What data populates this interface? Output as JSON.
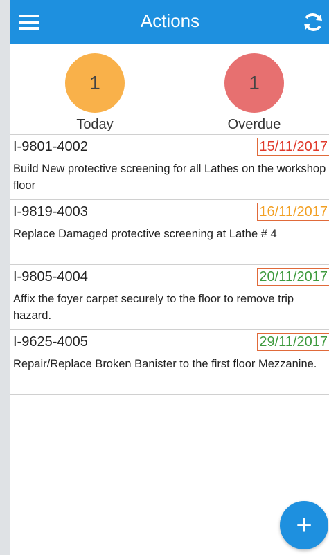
{
  "header": {
    "title": "Actions",
    "menu_icon": "hamburger-menu-icon",
    "sync_icon": "sync-icon"
  },
  "summary": {
    "today": {
      "count": "1",
      "label": "Today",
      "color": "#f9b14a"
    },
    "overdue": {
      "count": "1",
      "label": "Overdue",
      "color": "#e77070"
    }
  },
  "actions": [
    {
      "id": "I-9801-4002",
      "date": "15/11/2017",
      "date_color": "#e0392b",
      "description": "Build New protective screening for all Lathes on the workshop floor"
    },
    {
      "id": "I-9819-4003",
      "date": "16/11/2017",
      "date_color": "#f2a024",
      "description": "Replace Damaged protective screening at Lathe # 4"
    },
    {
      "id": "I-9805-4004",
      "date": "20/11/2017",
      "date_color": "#3e9a3e",
      "description": "Affix the foyer carpet securely to the floor to remove trip hazard."
    },
    {
      "id": "I-9625-4005",
      "date": "29/11/2017",
      "date_color": "#3e9a3e",
      "description": "Repair/Replace Broken Banister to the first floor Mezzanine."
    }
  ],
  "fab": {
    "label": "+"
  }
}
